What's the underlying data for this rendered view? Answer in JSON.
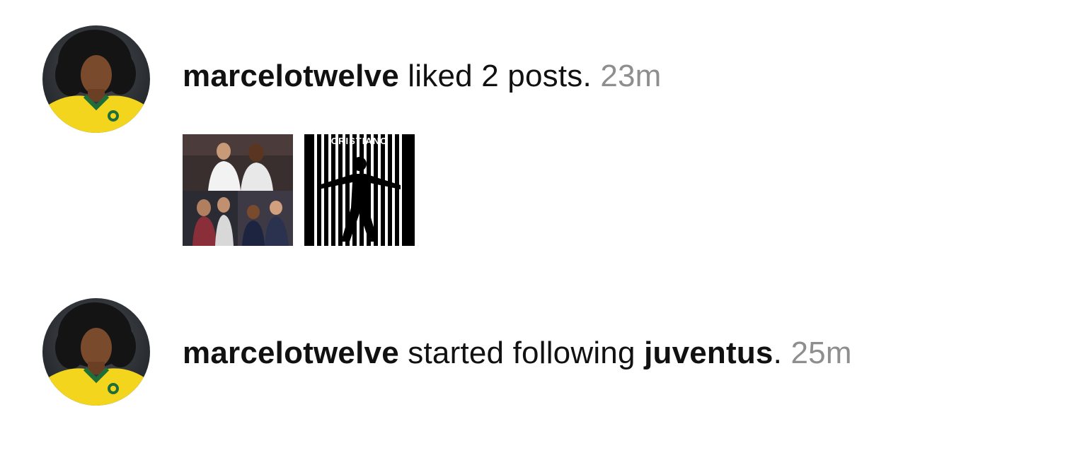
{
  "notifications": [
    {
      "username": "marcelotwelve",
      "action": " liked 2 posts.",
      "time": "23m",
      "avatar_icon": "user-avatar",
      "thumbnails": [
        {
          "icon": "photo-collage-thumbnail"
        },
        {
          "icon": "cristiano-poster-thumbnail",
          "text": "CRISTIANO"
        }
      ]
    },
    {
      "username": "marcelotwelve",
      "action": " started following ",
      "target": "juventus",
      "punct": ".",
      "time": "25m",
      "avatar_icon": "user-avatar"
    }
  ],
  "colors": {
    "text": "#111111",
    "time": "#8e8e8e",
    "jersey": "#f3d51d",
    "jersey_trim": "#1f6e3a",
    "background": "#ffffff"
  }
}
